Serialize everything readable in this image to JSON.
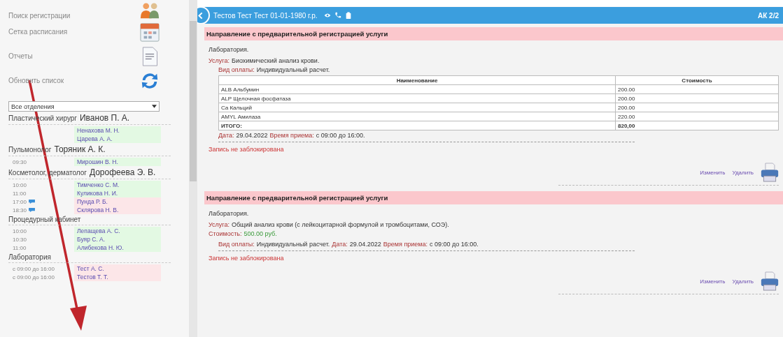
{
  "sidebar": {
    "menu": [
      {
        "label": "Поиск регистрации"
      },
      {
        "label": "Сетка расписания"
      },
      {
        "label": "Отчеты"
      },
      {
        "label": "Обновить список"
      }
    ],
    "department_select": {
      "value": "Все отделения"
    },
    "groups": [
      {
        "specialty": "Пластический хирург",
        "doctor": "Иванов П. А.",
        "entries": [
          {
            "patient": "Ненахова М. Н.",
            "color": "#e3f9e3",
            "note": false
          },
          {
            "patient": "Царева А. А.",
            "color": "#e3f9e3",
            "note": false
          }
        ]
      },
      {
        "specialty": "Пульмонолог",
        "doctor": "Торяник А. К.",
        "entries": [
          {
            "time": "09:30",
            "patient": "Мирошин В. Н.",
            "color": "#e3f9e3",
            "note": false
          }
        ]
      },
      {
        "specialty": "Косметолог, дерматолог",
        "doctor": "Дорофеева Э. В.",
        "entries": [
          {
            "time": "10:00",
            "patient": "Тимченко С. М.",
            "color": "#e3f9e3",
            "note": false
          },
          {
            "time": "11:00",
            "patient": "Куликова Н. И.",
            "color": "#e3f9e3",
            "note": false
          },
          {
            "time": "17:00",
            "patient": "Пунда Р. Б.",
            "color": "#fce6e8",
            "note": true
          },
          {
            "time": "18:30",
            "patient": "Склярова Н. В.",
            "color": "#fce6e8",
            "note": true
          }
        ]
      },
      {
        "specialty": "Процедурный кабинет",
        "entries": [
          {
            "time": "10:00",
            "patient": "Лепащева А. С.",
            "color": "#e3f9e3",
            "note": false
          },
          {
            "time": "10:30",
            "patient": "Буяр С. А.",
            "color": "#e3f9e3",
            "note": false
          },
          {
            "time": "11:00",
            "patient": "Алибекова Н. Ю.",
            "color": "#e3f9e3",
            "note": false
          }
        ]
      },
      {
        "specialty": "Лаборатория",
        "entries": [
          {
            "time": "с 09:00 до 16:00",
            "patient": "Тест А. С.",
            "color": "#fce6e8",
            "note": false
          },
          {
            "time": "с 09:00 до 16:00",
            "patient": "Тестов Т. Т.",
            "color": "#fce6e8",
            "note": false
          }
        ]
      }
    ]
  },
  "header": {
    "patient": "Тестов Тест Тест 01-01-1980 г.р.",
    "right": "АК 2/2"
  },
  "referrals": [
    {
      "kind": "table",
      "title": "Направление с предварительной регистрацией услуги",
      "department": "Лаборатория.",
      "service_label": "Услуга:",
      "service": "Биохимический анализ крови.",
      "payment_label": "Вид оплаты:",
      "payment": "Индивидуальный расчет.",
      "table": {
        "columns": [
          "Наименование",
          "Стоимость"
        ],
        "rows": [
          [
            "ALB Альбумин",
            "200.00"
          ],
          [
            "ALP Щелочная фосфатаза",
            "200.00"
          ],
          [
            "Ca Кальций",
            "200.00"
          ],
          [
            "AMYL Амилаза",
            "220.00"
          ]
        ],
        "total": [
          "ИТОГО:",
          "820,00"
        ]
      },
      "date_label": "Дата:",
      "date": "29.04.2022",
      "time_label": "Время приема:",
      "time": "с 09:00 до 16:00.",
      "status": "Запись не заблокирована",
      "actions": [
        "Изменить",
        "Удалить"
      ]
    },
    {
      "kind": "cost",
      "title": "Направление с предварительной регистрацией услуги",
      "department": "Лаборатория.",
      "service_label": "Услуга:",
      "service": "Общий анализ крови (с лейкоцитарной формулой и тромбоцитами, СОЭ).",
      "cost_label": "Стоимость:",
      "cost": "500.00 руб.",
      "payment_label": "Вид оплаты:",
      "payment": "Индивидуальный расчет.",
      "date_label": "Дата:",
      "date": "29.04.2022",
      "time_label": "Время приема:",
      "time": "с 09:00 до 16:00.",
      "status": "Запись не заблокирована",
      "actions": [
        "Изменить",
        "Удалить"
      ]
    }
  ]
}
